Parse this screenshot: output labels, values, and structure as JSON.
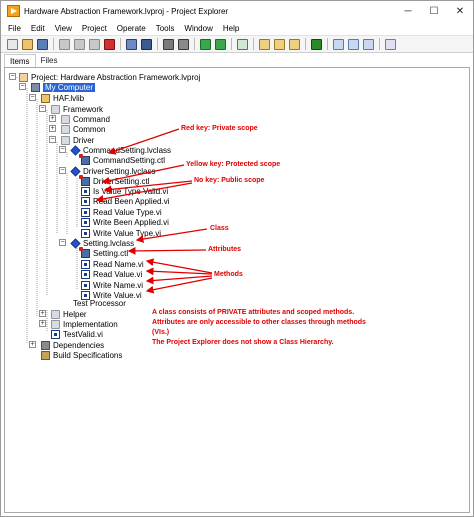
{
  "window": {
    "title": "Hardware Abstraction Framework.lvproj - Project Explorer",
    "controls": {
      "minimize": "─",
      "maximize": "☐",
      "close": "✕"
    }
  },
  "menu": [
    "File",
    "Edit",
    "View",
    "Project",
    "Operate",
    "Tools",
    "Window",
    "Help"
  ],
  "toolbar": {
    "buttons": [
      "new",
      "open",
      "save-all",
      "cut",
      "copy",
      "paste",
      "delete",
      "build",
      "deploy",
      "run",
      "add-item",
      "expand",
      "collapse",
      "properties",
      "filter",
      "settings",
      "help"
    ]
  },
  "tabs": {
    "items": "Items",
    "files": "Files"
  },
  "tree": {
    "project": "Project: Hardware Abstraction Framework.lvproj",
    "my_computer": "My Computer",
    "haf_lib": "HAF.lvlib",
    "framework": "Framework",
    "command": "Command",
    "common": "Common",
    "driver": "Driver",
    "command_setting_class": "CommandSetting.lvclass",
    "command_setting_ctl": "CommandSetting.ctl",
    "driver_setting_class": "DriverSetting.lvclass",
    "driver_setting_ctl": "DriverSetting.ctl",
    "is_value_type_valid": "Is Value Type Valid.vi",
    "read_been_applied": "Read Been Applied.vi",
    "read_value_type": "Read Value Type.vi",
    "write_been_applied": "Write Been Applied.vi",
    "write_value_type": "Write Value Type.vi",
    "setting_class": "Setting.lvclass",
    "setting_ctl": "Setting.ctl",
    "read_name": "Read Name.vi",
    "read_value": "Read Value.vi",
    "write_name": "Write Name.vi",
    "write_value": "Write Value.vi",
    "test_processor": "Test Processor",
    "helper": "Helper",
    "implementation": "Implementation",
    "test_valid": "TestValid.vi",
    "dependencies": "Dependencies",
    "build_specifications": "Build Specifications"
  },
  "annotations": {
    "red_key": "Red key: Private scope",
    "yellow_key": "Yellow key: Protected scope",
    "no_key": "No key: Public scope",
    "class": "Class",
    "attributes": "Attributes",
    "methods": "Methods",
    "note_line1": "A class consists of PRIVATE attributes and scoped methods.",
    "note_line2": "Attributes are only accessible to other classes through methods",
    "note_line3": "(VIs.)",
    "note_line4": "The Project Explorer does not show a Class Hierarchy."
  },
  "colors": {
    "annotation": "#e00000",
    "selection": "#2a64d4",
    "app_icon": "#f3a21b"
  }
}
